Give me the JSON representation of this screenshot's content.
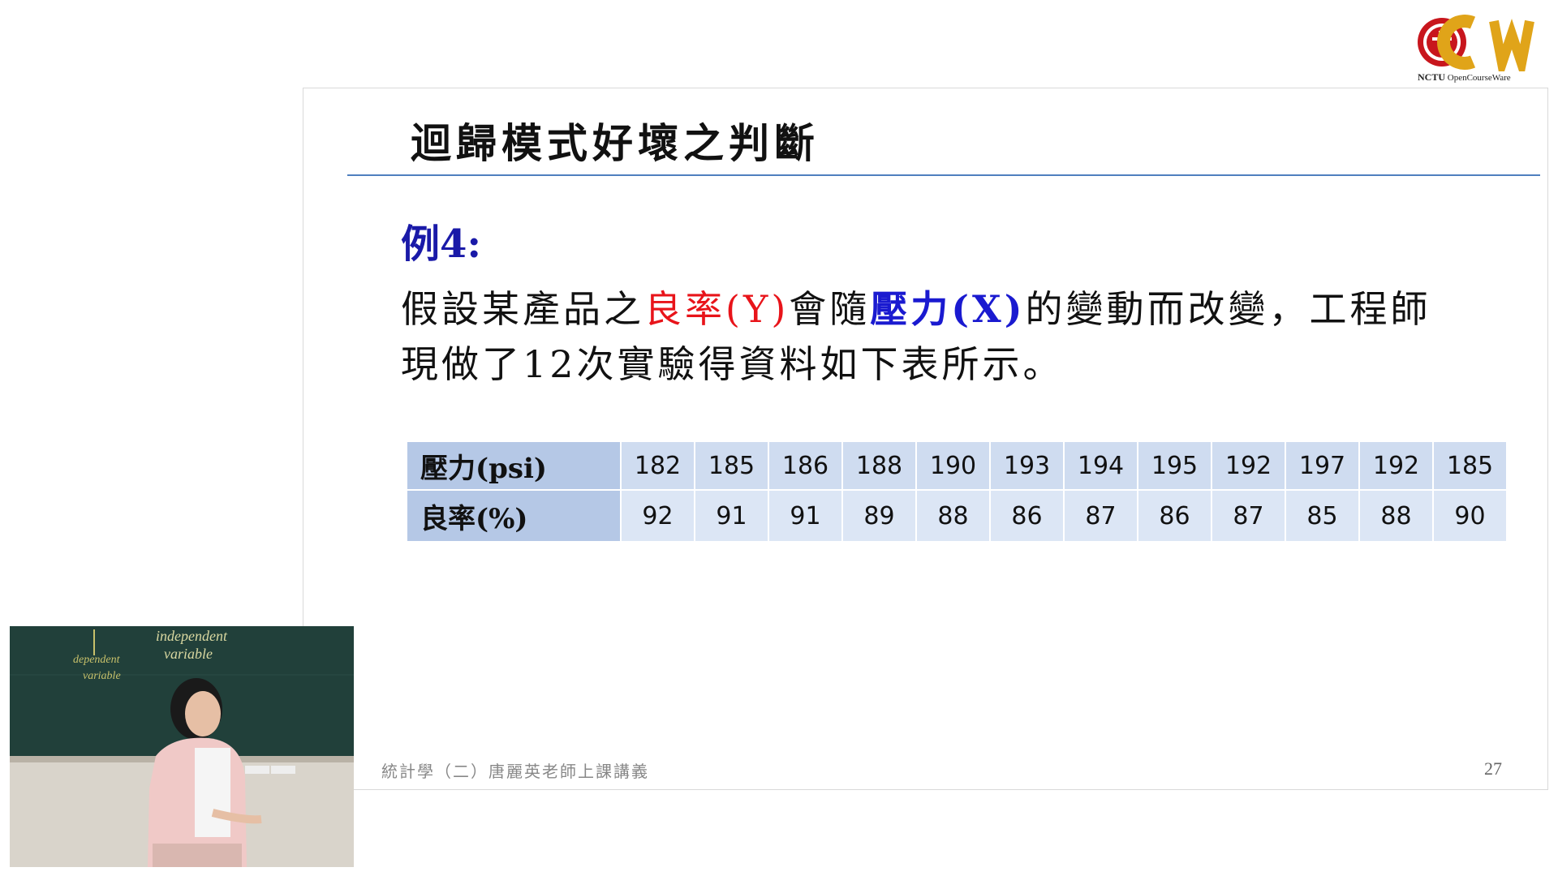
{
  "logo": {
    "brand": "OCW",
    "caption_bold": "NCTU",
    "caption": "OpenCourseWare"
  },
  "slide": {
    "title": "迴歸模式好壞之判斷",
    "example_label": "例4:",
    "paragraph": {
      "line1_part1": "假設某產品之",
      "line1_red": "良率(Y)",
      "line1_part2": "會隨",
      "line1_blue": "壓力(X)",
      "line1_part3": "的變動而改變，工程師",
      "line2": "現做了12次實驗得資料如下表所示。"
    },
    "table": {
      "rows": [
        {
          "header": "壓力(psi)",
          "values": [
            "182",
            "185",
            "186",
            "188",
            "190",
            "193",
            "194",
            "195",
            "192",
            "197",
            "192",
            "185"
          ]
        },
        {
          "header": "良率(%)",
          "values": [
            "92",
            "91",
            "91",
            "89",
            "88",
            "86",
            "87",
            "86",
            "87",
            "85",
            "88",
            "90"
          ]
        }
      ]
    },
    "footer": "統計學（二）唐麗英老師上課講義",
    "page_number": "27"
  },
  "video": {
    "chalk_text": [
      "independent",
      "variable",
      "dependent",
      "variable"
    ]
  },
  "colors": {
    "title_rule": "#4f7fbf",
    "red_text": "#e8141a",
    "blue_text": "#1a1ad0",
    "example_label": "#1a1aa8",
    "table_header_bg": "#b5c8e6",
    "table_cell_bg": "#cfdcf0",
    "logo_red": "#c8161d",
    "logo_gold": "#e0a419"
  }
}
